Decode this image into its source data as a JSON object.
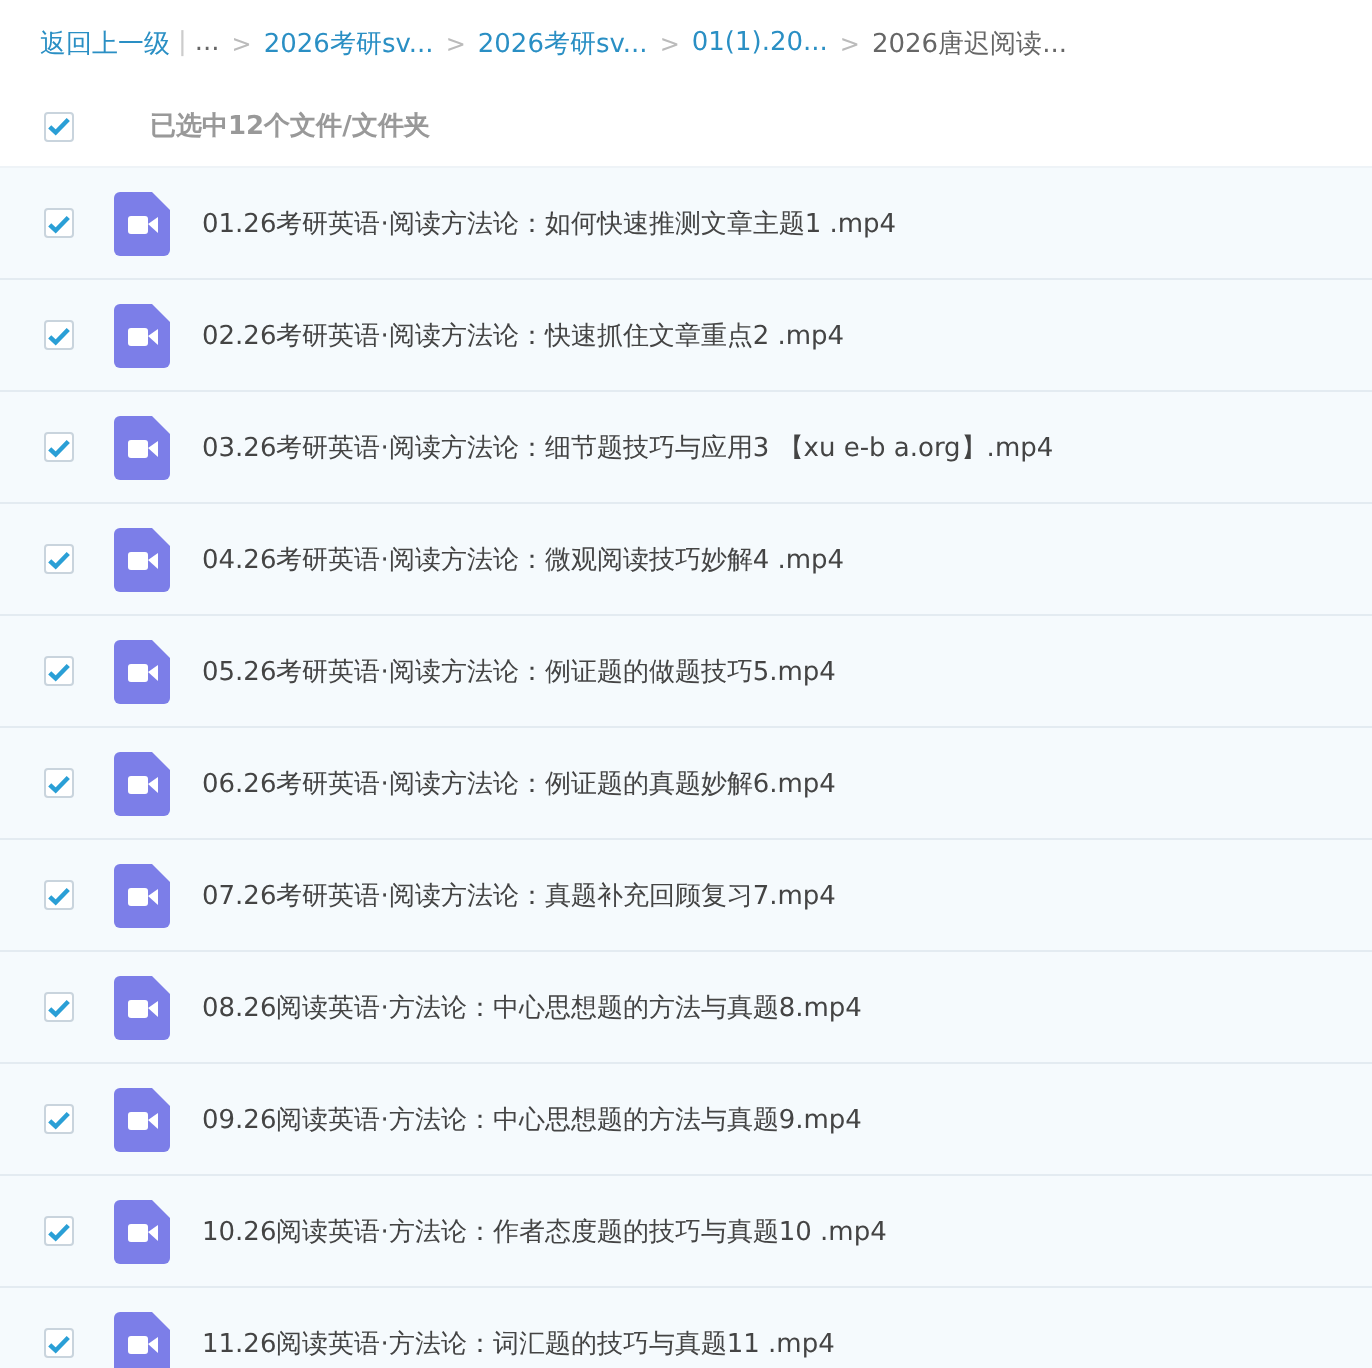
{
  "breadcrumb": {
    "back": "返回上一级",
    "divider": "|",
    "items": [
      {
        "kind": "ellipsis",
        "label": "...",
        "separator": ">"
      },
      {
        "kind": "link",
        "label": "2026考研sv...",
        "separator": ">"
      },
      {
        "kind": "link",
        "label": "2026考研sv...",
        "separator": ">"
      },
      {
        "kind": "link",
        "label": "01(1).20...",
        "separator": ">"
      },
      {
        "kind": "current",
        "label": "2026唐迟阅读..."
      }
    ]
  },
  "selection": {
    "checked": true,
    "label": "已选中12个文件/文件夹"
  },
  "files": [
    {
      "checked": true,
      "name": "01.26考研英语·阅读方法论：如何快速推测文章主题1 .mp4"
    },
    {
      "checked": true,
      "name": "02.26考研英语·阅读方法论：快速抓住文章重点2 .mp4"
    },
    {
      "checked": true,
      "name": "03.26考研英语·阅读方法论：细节题技巧与应用3 【xu e-b a.org】.mp4"
    },
    {
      "checked": true,
      "name": "04.26考研英语·阅读方法论：微观阅读技巧妙解4 .mp4"
    },
    {
      "checked": true,
      "name": "05.26考研英语·阅读方法论：例证题的做题技巧5.mp4"
    },
    {
      "checked": true,
      "name": "06.26考研英语·阅读方法论：例证题的真题妙解6.mp4"
    },
    {
      "checked": true,
      "name": "07.26考研英语·阅读方法论：真题补充回顾复习7.mp4"
    },
    {
      "checked": true,
      "name": "08.26阅读英语·方法论：中心思想题的方法与真题8.mp4"
    },
    {
      "checked": true,
      "name": "09.26阅读英语·方法论：中心思想题的方法与真题9.mp4"
    },
    {
      "checked": true,
      "name": "10.26阅读英语·方法论：作者态度题的技巧与真题10 .mp4"
    },
    {
      "checked": true,
      "name": "11.26阅读英语·方法论：词汇题的技巧与真题11 .mp4"
    }
  ]
}
